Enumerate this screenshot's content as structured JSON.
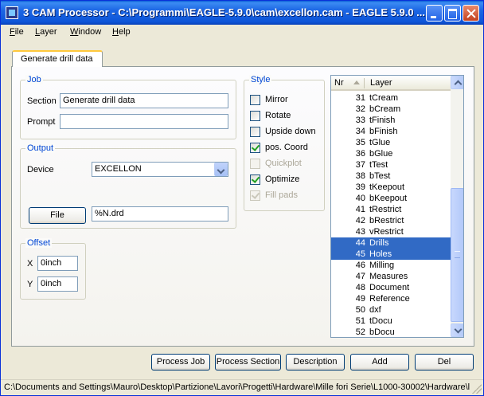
{
  "window": {
    "title": "3 CAM Processor - C:\\Programmi\\EAGLE-5.9.0\\cam\\excellon.cam - EAGLE 5.9.0 ..."
  },
  "menu": [
    "File",
    "Layer",
    "Window",
    "Help"
  ],
  "tab": {
    "label": "Generate drill data"
  },
  "job": {
    "group_label": "Job",
    "section_label": "Section",
    "section_value": "Generate drill data",
    "prompt_label": "Prompt",
    "prompt_value": ""
  },
  "output": {
    "group_label": "Output",
    "device_label": "Device",
    "device_value": "EXCELLON",
    "file_button": "File",
    "file_value": "%N.drd"
  },
  "offset": {
    "group_label": "Offset",
    "x_label": "X",
    "x_value": "0inch",
    "y_label": "Y",
    "y_value": "0inch"
  },
  "style": {
    "group_label": "Style",
    "options": [
      {
        "label": "Mirror",
        "checked": false,
        "enabled": true
      },
      {
        "label": "Rotate",
        "checked": false,
        "enabled": true
      },
      {
        "label": "Upside down",
        "checked": false,
        "enabled": true
      },
      {
        "label": "pos. Coord",
        "checked": true,
        "enabled": true
      },
      {
        "label": "Quickplot",
        "checked": false,
        "enabled": false
      },
      {
        "label": "Optimize",
        "checked": true,
        "enabled": true
      },
      {
        "label": "Fill pads",
        "checked": true,
        "enabled": false
      }
    ]
  },
  "layers": {
    "col_nr": "Nr",
    "col_layer": "Layer",
    "rows": [
      {
        "nr": "31",
        "name": "tCream",
        "selected": false
      },
      {
        "nr": "32",
        "name": "bCream",
        "selected": false
      },
      {
        "nr": "33",
        "name": "tFinish",
        "selected": false
      },
      {
        "nr": "34",
        "name": "bFinish",
        "selected": false
      },
      {
        "nr": "35",
        "name": "tGlue",
        "selected": false
      },
      {
        "nr": "36",
        "name": "bGlue",
        "selected": false
      },
      {
        "nr": "37",
        "name": "tTest",
        "selected": false
      },
      {
        "nr": "38",
        "name": "bTest",
        "selected": false
      },
      {
        "nr": "39",
        "name": "tKeepout",
        "selected": false
      },
      {
        "nr": "40",
        "name": "bKeepout",
        "selected": false
      },
      {
        "nr": "41",
        "name": "tRestrict",
        "selected": false
      },
      {
        "nr": "42",
        "name": "bRestrict",
        "selected": false
      },
      {
        "nr": "43",
        "name": "vRestrict",
        "selected": false
      },
      {
        "nr": "44",
        "name": "Drills",
        "selected": true
      },
      {
        "nr": "45",
        "name": "Holes",
        "selected": true
      },
      {
        "nr": "46",
        "name": "Milling",
        "selected": false
      },
      {
        "nr": "47",
        "name": "Measures",
        "selected": false
      },
      {
        "nr": "48",
        "name": "Document",
        "selected": false
      },
      {
        "nr": "49",
        "name": "Reference",
        "selected": false
      },
      {
        "nr": "50",
        "name": "dxf",
        "selected": false
      },
      {
        "nr": "51",
        "name": "tDocu",
        "selected": false
      },
      {
        "nr": "52",
        "name": "bDocu",
        "selected": false
      }
    ]
  },
  "buttons": {
    "process_job": "Process Job",
    "process_section": "Process Section",
    "description": "Description",
    "add": "Add",
    "del": "Del"
  },
  "status": {
    "text": "C:\\Documents and Settings\\Mauro\\Desktop\\Partizione\\Lavori\\Progetti\\Hardware\\Mille fori Serie\\L1000-30002\\Hardware\\l"
  },
  "colors": {
    "title_bar": "#0a5fd6",
    "group_label": "#0046d5",
    "selection": "#316ac5",
    "check_mark": "#21a121"
  }
}
